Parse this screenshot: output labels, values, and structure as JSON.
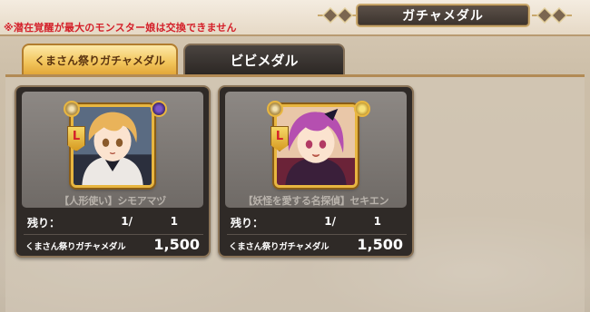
{
  "notice": "※潜在覚醒が最大のモンスター娘は交換できません",
  "title": "ガチャメダル",
  "tabs": [
    {
      "label": "くまさん祭りガチャメダル",
      "active": true
    },
    {
      "label": "ビビメダル",
      "active": false
    }
  ],
  "remaining_label": "残り：",
  "items": [
    {
      "name": "【人形使い】シモアマヅ",
      "remaining": "1/",
      "max": "1",
      "currency": "くまさん祭りガチャメダル",
      "cost": "1,500",
      "rank": "L",
      "hair_color": "#e9b35a",
      "portrait_icons": [
        "spiral-icon",
        "attribute-dark-icon"
      ]
    },
    {
      "name": "【妖怪を愛する名探偵】セキエン",
      "remaining": "1/",
      "max": "1",
      "currency": "くまさん祭りガチャメダル",
      "cost": "1,500",
      "rank": "L",
      "hair_color": "#b54fb0",
      "portrait_icons": [
        "crosshair-icon",
        "attribute-light-icon"
      ]
    }
  ],
  "colors": {
    "notice": "#d4202a",
    "active_tab": "#f2c45a",
    "frame_gold": "#e8b640"
  }
}
